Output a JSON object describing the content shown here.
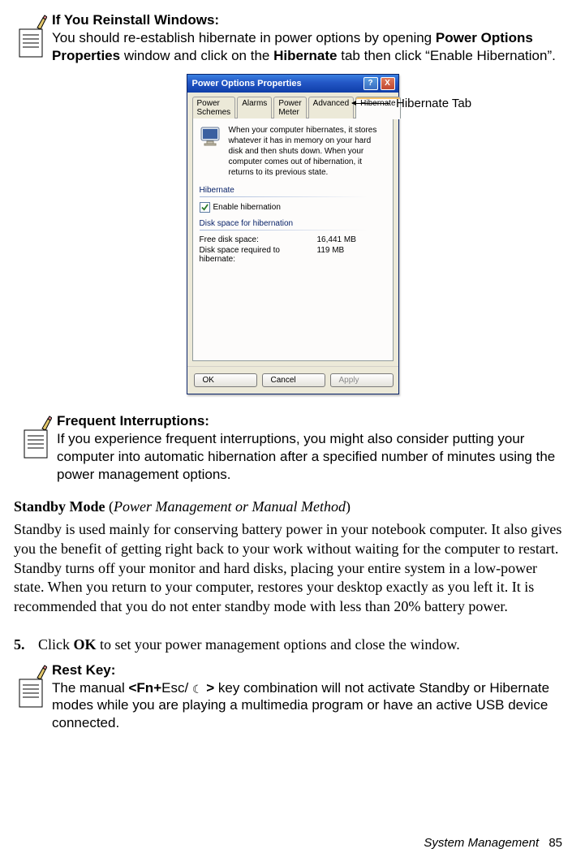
{
  "note1": {
    "title": "If You Reinstall Windows:",
    "line_a": "You should re-establish hibernate in power options by opening ",
    "line_b": "Power Options Properties",
    "line_c": " window and click on the ",
    "line_d": "Hibernate",
    "line_e": " tab then click “Enable Hibernation”."
  },
  "callout_label": "Hibernate Tab",
  "dialog": {
    "title": "Power Options Properties",
    "title_help": "?",
    "title_close": "X",
    "tabs": {
      "t0": "Power Schemes",
      "t1": "Alarms",
      "t2": "Power Meter",
      "t3": "Advanced",
      "t4": "Hibernate"
    },
    "info_text": "When your computer hibernates, it stores whatever it has in memory on your hard disk and then shuts down. When your computer comes out of hibernation, it returns to its previous state.",
    "group1_title": "Hibernate",
    "checkbox_label": "Enable hibernation",
    "group2_title": "Disk space for hibernation",
    "row1_k": "Free disk space:",
    "row1_v": "16,441 MB",
    "row2_k": "Disk space required to hibernate:",
    "row2_v": "119 MB",
    "btn_ok": "OK",
    "btn_cancel": "Cancel",
    "btn_apply": "Apply"
  },
  "note2": {
    "title": "Frequent Interruptions:",
    "body": "If you experience frequent interruptions, you might also consider putting your computer into automatic hibernation after a specified number of minutes using the power management options."
  },
  "standby": {
    "heading_bold": "Standby Mode ",
    "heading_paren_open": "(",
    "heading_italic": "Power Management or Manual Method",
    "heading_paren_close": ")",
    "body": "Standby is used mainly for conserving battery power in your notebook computer. It also gives you the benefit of getting right back to your work without waiting for the computer to restart. Standby turns off your monitor and hard disks, placing your entire system in a low-power state. When you return to your computer, restores your desktop exactly as you left it. It is recommended that you do not enter standby mode with less than 20% battery power."
  },
  "step5": {
    "num": "5.",
    "a": "Click ",
    "b": "OK",
    "c": " to set your power management options and close the window."
  },
  "note3": {
    "title": "Rest Key:",
    "a": "The manual ",
    "b": "<Fn+",
    "c": "Esc/ ",
    "moon": "☾",
    "d": " >",
    "e": " key combination will not activate Standby or Hibernate modes while you are playing a multimedia program or have an active USB device connected."
  },
  "footer": {
    "label": "System Management",
    "page": "85"
  }
}
